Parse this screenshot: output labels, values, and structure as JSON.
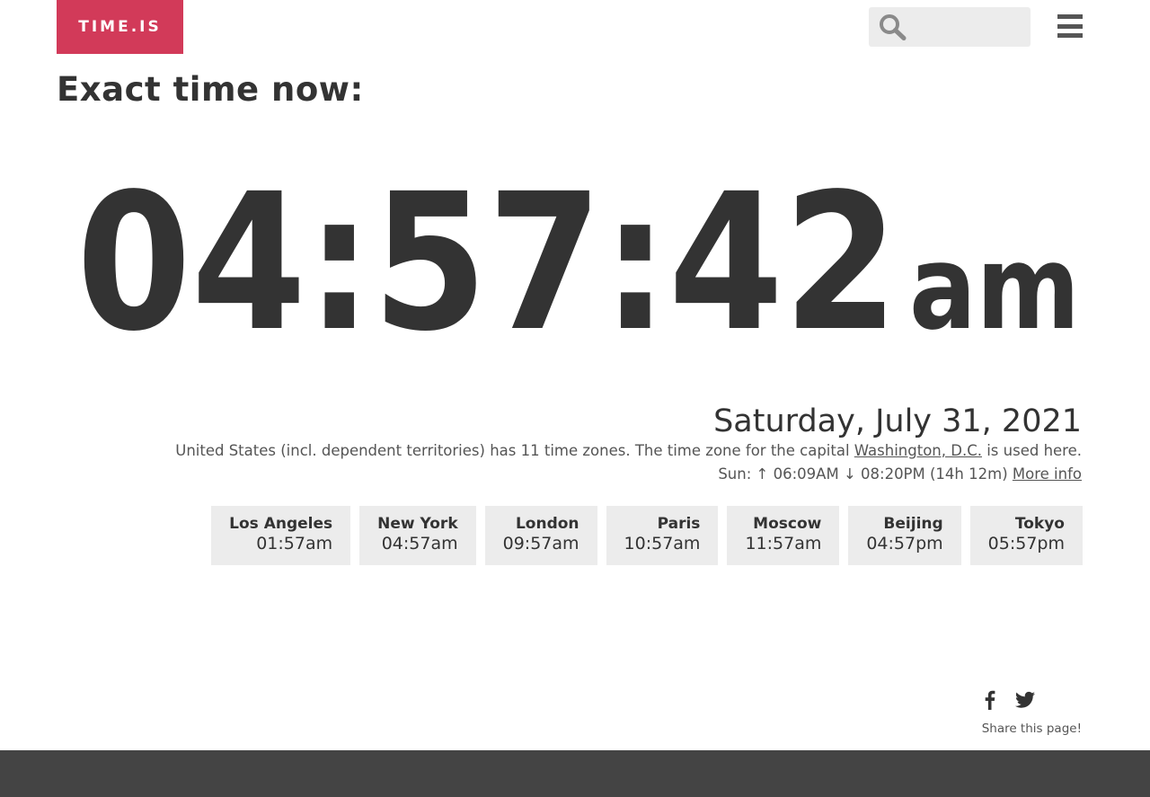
{
  "header": {
    "logo_text": "TIME.IS",
    "search_placeholder": "",
    "search_icon": "search-icon",
    "menu_icon": "hamburger-menu-icon"
  },
  "page_title": "Exact time now:",
  "clock": {
    "time": "04:57:42",
    "ampm": "am"
  },
  "date": "Saturday, July 31, 2021",
  "timezone_info": {
    "text_before": "United States (incl. dependent territories) has 11 time zones. The time zone for the capital ",
    "capital_link": "Washington, D.C.",
    "text_after": " is used here."
  },
  "sun": {
    "label": "Sun: ",
    "rise_arrow": "↑",
    "rise": " 06:09AM ",
    "set_arrow": "↓",
    "set": " 08:20PM (14h 12m) ",
    "more_link": "More info"
  },
  "cities": [
    {
      "name": "Los Angeles",
      "time": "01:57am"
    },
    {
      "name": "New York",
      "time": "04:57am"
    },
    {
      "name": "London",
      "time": "09:57am"
    },
    {
      "name": "Paris",
      "time": "10:57am"
    },
    {
      "name": "Moscow",
      "time": "11:57am"
    },
    {
      "name": "Beijing",
      "time": "04:57pm"
    },
    {
      "name": "Tokyo",
      "time": "05:57pm"
    }
  ],
  "share": {
    "label": "Share this page!",
    "icons": [
      "facebook-icon",
      "twitter-icon"
    ]
  },
  "colors": {
    "brand": "#d23a59",
    "text": "#333333",
    "tile_bg": "#ececec",
    "footer_bg": "#444444"
  }
}
